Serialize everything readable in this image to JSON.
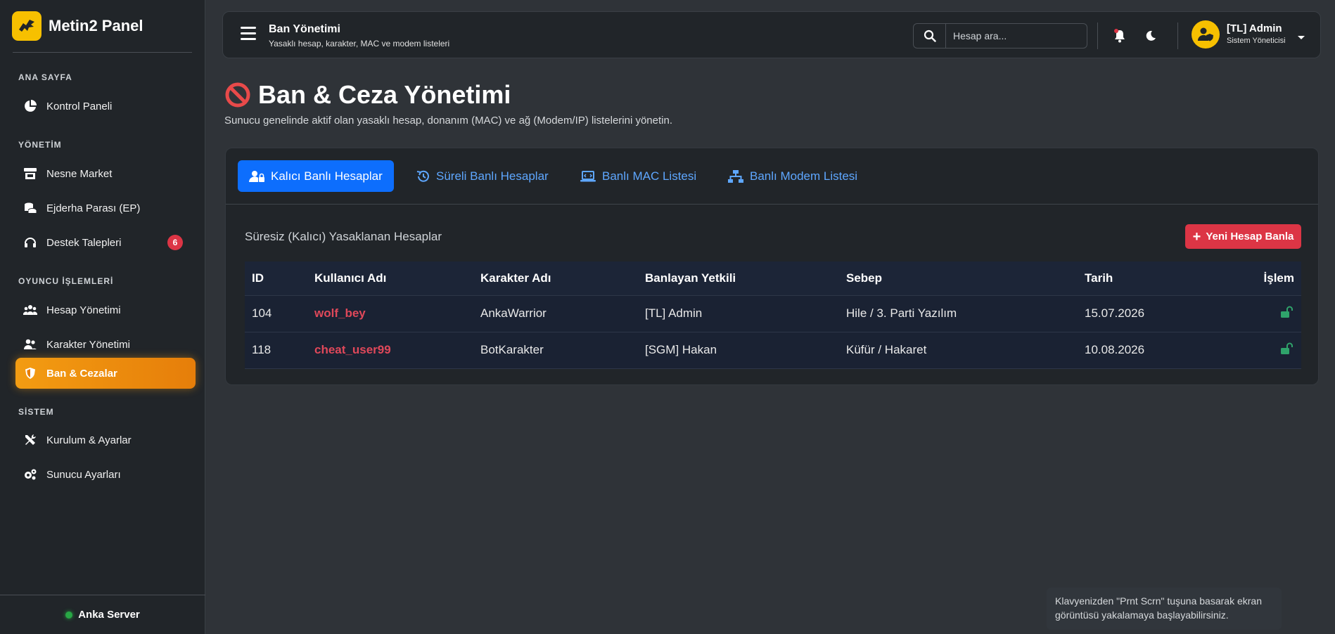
{
  "brand": {
    "name": "Metin2 Panel"
  },
  "sidebar": {
    "sections": [
      "ANA SAYFA",
      "YÖNETİM",
      "OYUNCU İŞLEMLERİ",
      "SİSTEM"
    ],
    "items": [
      {
        "label": "Kontrol Paneli"
      },
      {
        "label": "Nesne Market"
      },
      {
        "label": "Ejderha Parası (EP)"
      },
      {
        "label": "Destek Talepleri",
        "badge": "6"
      },
      {
        "label": "Hesap Yönetimi"
      },
      {
        "label": "Karakter Yönetimi"
      },
      {
        "label": "Ban & Cezalar"
      },
      {
        "label": "Kurulum & Ayarlar"
      },
      {
        "label": "Sunucu Ayarları"
      }
    ],
    "server": "Anka Server"
  },
  "topbar": {
    "title": "Ban Yönetimi",
    "subtitle": "Yasaklı hesap, karakter, MAC ve modem listeleri",
    "search_placeholder": "Hesap ara...",
    "user_name": "[TL] Admin",
    "user_role": "Sistem Yöneticisi"
  },
  "page": {
    "title": "Ban & Ceza Yönetimi",
    "description": "Sunucu genelinde aktif olan yasaklı hesap, donanım (MAC) ve ağ (Modem/IP) listelerini yönetin."
  },
  "tabs": [
    {
      "label": "Kalıcı Banlı Hesaplar"
    },
    {
      "label": "Süreli Banlı Hesaplar"
    },
    {
      "label": "Banlı MAC Listesi"
    },
    {
      "label": "Banlı Modem Listesi"
    }
  ],
  "section": {
    "title": "Süresiz (Kalıcı) Yasaklanan Hesaplar",
    "add_button": "Yeni Hesap Banla"
  },
  "table": {
    "headers": [
      "ID",
      "Kullanıcı Adı",
      "Karakter Adı",
      "Banlayan Yetkili",
      "Sebep",
      "Tarih",
      "İşlem"
    ],
    "rows": [
      {
        "id": "104",
        "user": "wolf_bey",
        "character": "AnkaWarrior",
        "by": "[TL] Admin",
        "reason": "Hile / 3. Parti Yazılım",
        "date": "15.07.2026"
      },
      {
        "id": "118",
        "user": "cheat_user99",
        "character": "BotKarakter",
        "by": "[SGM] Hakan",
        "reason": "Küfür / Hakaret",
        "date": "10.08.2026"
      }
    ]
  },
  "toast": {
    "text": "Klavyenizden \"Prnt Scrn\" tuşuna basarak ekran görüntüsü yakalamaya başlayabilirsiniz."
  },
  "colors": {
    "accent": "#f39c12",
    "primary": "#0d6efd",
    "danger": "#dc3545",
    "success": "#28a745"
  }
}
